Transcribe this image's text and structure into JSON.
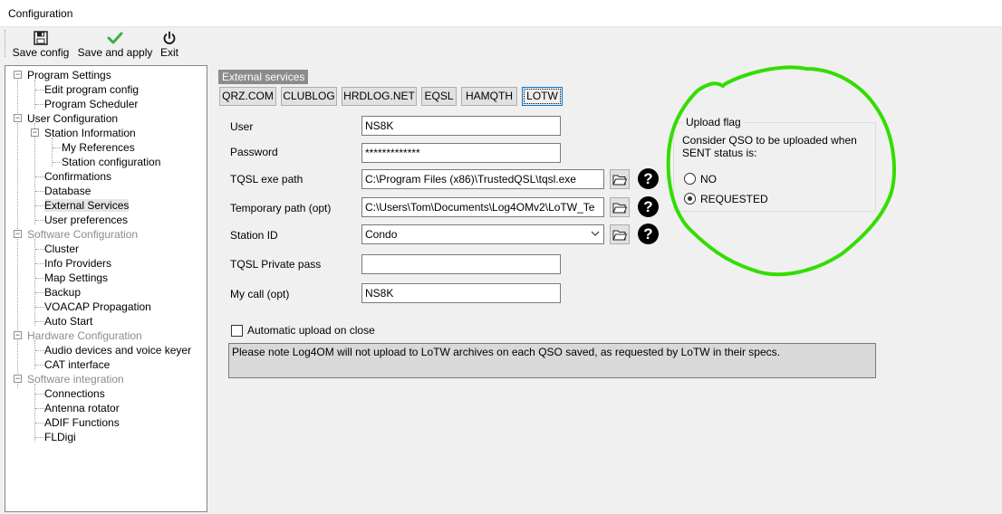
{
  "window": {
    "title": "Configuration"
  },
  "toolbar": {
    "save_config": "Save config",
    "save_and_apply": "Save and apply",
    "exit": "Exit"
  },
  "tree": {
    "program_settings": "Program Settings",
    "edit_program_config": "Edit program config",
    "program_scheduler": "Program Scheduler",
    "user_configuration": "User Configuration",
    "station_information": "Station Information",
    "my_references": "My References",
    "station_configuration": "Station configuration",
    "confirmations": "Confirmations",
    "database": "Database",
    "external_services": "External Services",
    "user_preferences": "User preferences",
    "software_configuration": "Software Configuration",
    "cluster": "Cluster",
    "info_providers": "Info Providers",
    "map_settings": "Map Settings",
    "backup": "Backup",
    "voacap_propagation": "VOACAP Propagation",
    "auto_start": "Auto Start",
    "hardware_configuration": "Hardware Configuration",
    "audio_devices": "Audio devices and voice keyer",
    "cat_interface": "CAT interface",
    "software_integration": "Software integration",
    "connections": "Connections",
    "antenna_rotator": "Antenna rotator",
    "adif_functions": "ADIF Functions",
    "fldigi": "FLDigi",
    "expander_symbol": "−"
  },
  "services": {
    "header": "External services",
    "tabs": [
      "QRZ.COM",
      "CLUBLOG",
      "HRDLOG.NET",
      "EQSL",
      "HAMQTH",
      "LOTW"
    ],
    "active_tab": "LOTW"
  },
  "lotw": {
    "user_label": "User",
    "user_value": "NS8K",
    "password_label": "Password",
    "password_value": "*************",
    "tqsl_path_label": "TQSL exe path",
    "tqsl_path_value": "C:\\Program Files (x86)\\TrustedQSL\\tqsl.exe",
    "temp_path_label": "Temporary path (opt)",
    "temp_path_value": "C:\\Users\\Tom\\Documents\\Log4OMv2\\LoTW_Te",
    "station_id_label": "Station ID",
    "station_id_value": "Condo",
    "tqsl_private_pass_label": "TQSL Private pass",
    "tqsl_private_pass_value": "",
    "my_call_label": "My call (opt)",
    "my_call_value": "NS8K",
    "auto_upload_label": "Automatic upload on close",
    "auto_upload_checked": false,
    "note": "Please note Log4OM will not upload to LoTW archives on each QSO saved, as requested by LoTW in their specs.",
    "help_symbol": "?"
  },
  "upload_flag": {
    "legend": "Upload flag",
    "description_line1": "Consider QSO to be uploaded when",
    "description_line2": "SENT status is:",
    "options": [
      "NO",
      "REQUESTED"
    ],
    "selected": "REQUESTED"
  },
  "colors": {
    "annotation": "#33dd00",
    "tree_border": "#828790",
    "header_bg": "#8c8c8c",
    "accent": "#0078d7"
  }
}
